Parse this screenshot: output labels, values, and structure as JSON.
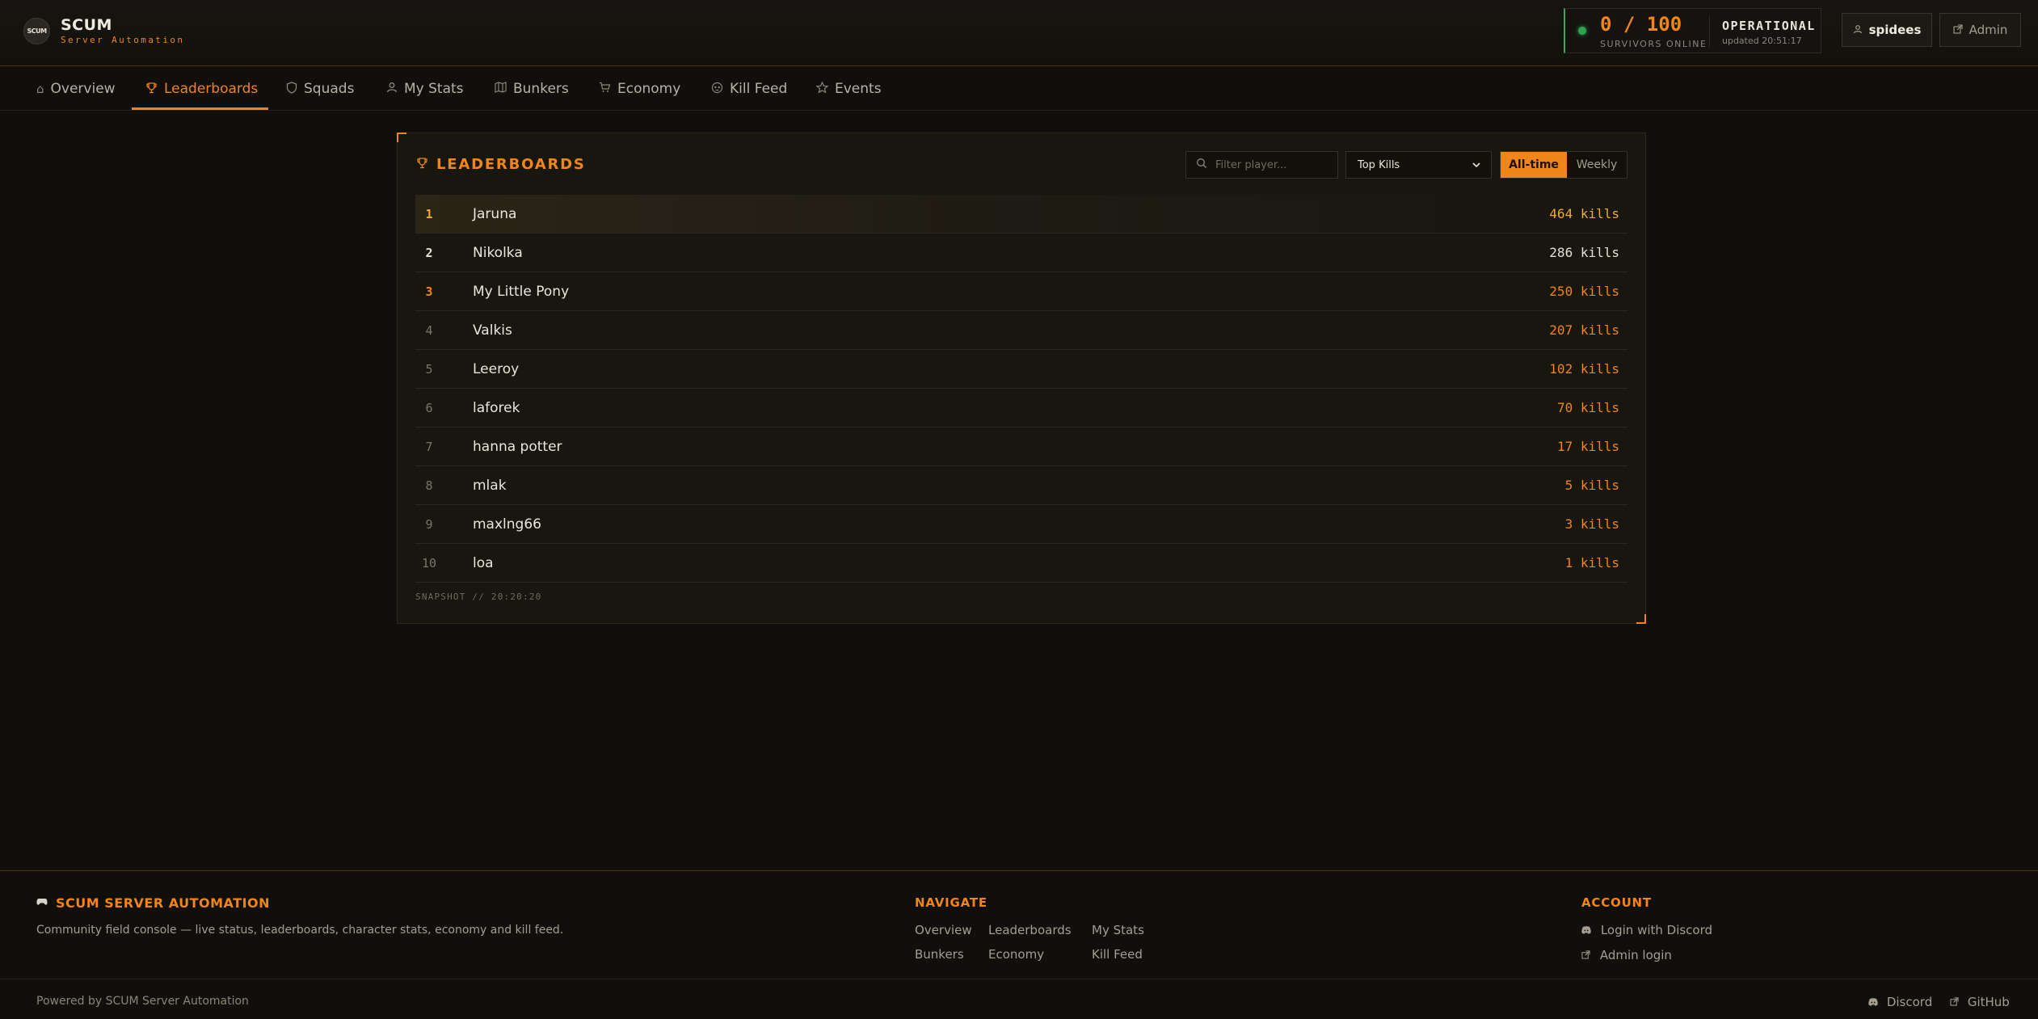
{
  "brand": {
    "logo_text": "SCUM",
    "title": "SCUM",
    "subtitle": "Server Automation"
  },
  "status": {
    "online": "0 / 100",
    "online_label": "SURVIVORS ONLINE",
    "state": "OPERATIONAL",
    "updated": "updated 20:51:17",
    "state_color": "#2fa44f"
  },
  "header": {
    "user_label": "spidees",
    "admin_label": "Admin"
  },
  "nav": {
    "tabs": [
      {
        "label": "Overview",
        "icon": "home-icon"
      },
      {
        "label": "Leaderboards",
        "icon": "trophy-icon",
        "active": true
      },
      {
        "label": "Squads",
        "icon": "shield-icon"
      },
      {
        "label": "My Stats",
        "icon": "user-icon"
      },
      {
        "label": "Bunkers",
        "icon": "map-icon"
      },
      {
        "label": "Economy",
        "icon": "cart-icon"
      },
      {
        "label": "Kill Feed",
        "icon": "skull-icon"
      },
      {
        "label": "Events",
        "icon": "star-icon"
      }
    ]
  },
  "leaderboard": {
    "title": "LEADERBOARDS",
    "filter_placeholder": "Filter player...",
    "metric": "Top Kills",
    "periods": [
      "All-time",
      "Weekly"
    ],
    "active_period": "All-time",
    "rows": [
      {
        "rank": "1",
        "name": "Jaruna",
        "value": "464 kills"
      },
      {
        "rank": "2",
        "name": "Nikolka",
        "value": "286 kills"
      },
      {
        "rank": "3",
        "name": "My Little Pony",
        "value": "250 kills"
      },
      {
        "rank": "4",
        "name": "Valkis",
        "value": "207 kills"
      },
      {
        "rank": "5",
        "name": "Leeroy",
        "value": "102 kills"
      },
      {
        "rank": "6",
        "name": "laforek",
        "value": "70 kills"
      },
      {
        "rank": "7",
        "name": "hanna potter",
        "value": "17 kills"
      },
      {
        "rank": "8",
        "name": "mlak",
        "value": "5 kills"
      },
      {
        "rank": "9",
        "name": "maxlng66",
        "value": "3 kills"
      },
      {
        "rank": "10",
        "name": "loa",
        "value": "1 kills"
      }
    ],
    "snapshot": "SNAPSHOT // 20:20:20"
  },
  "footer": {
    "brand": "SCUM SERVER AUTOMATION",
    "description": "Community field console — live status, leaderboards, character stats, economy and kill feed.",
    "navigate_heading": "NAVIGATE",
    "navigate_links": [
      "Overview",
      "Leaderboards",
      "My Stats",
      "Bunkers",
      "Economy",
      "Kill Feed"
    ],
    "account_heading": "ACCOUNT",
    "account_links": [
      "Login with Discord",
      "Admin login"
    ],
    "powered_by": "Powered by SCUM Server Automation",
    "bottom_links": [
      "Discord",
      "GitHub"
    ]
  },
  "colors": {
    "accent": "#f0851b",
    "gold": "#f0a83a",
    "background": "#100f0b"
  }
}
